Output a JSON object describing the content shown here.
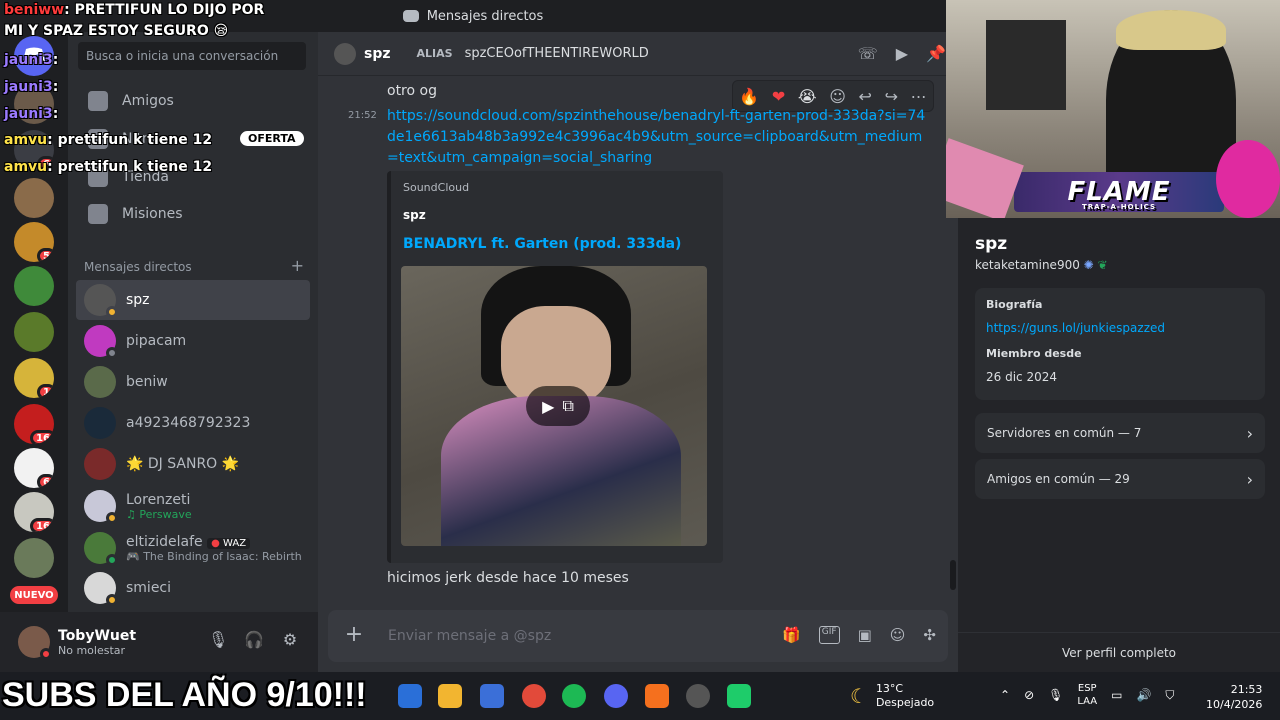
{
  "window": {
    "title": "Mensajes directos"
  },
  "sidebar": {
    "search_placeholder": "Busca o inicia una conversación",
    "nav": [
      {
        "label": "Amigos"
      },
      {
        "label": "Nitro"
      },
      {
        "label": "Tienda"
      },
      {
        "label": "Misiones"
      }
    ],
    "dm_header": "Mensajes directos",
    "dm_add": "+",
    "dms": [
      {
        "name": "spz",
        "sub": "",
        "active": true
      },
      {
        "name": "pipacam",
        "sub": ""
      },
      {
        "name": "beniw",
        "sub": ""
      },
      {
        "name": "a4923468792323",
        "sub": ""
      },
      {
        "name": "🌟 DJ SANRO 🌟",
        "sub": ""
      },
      {
        "name": "Lorenzeti",
        "sub": "♫ Perswave"
      },
      {
        "name": "eltizidelafe",
        "tag": "WAZ",
        "sub": "🎮 The Binding of Isaac: Rebirth"
      },
      {
        "name": "smieci",
        "sub": ""
      }
    ]
  },
  "rail": {
    "badges": [
      "6",
      "5",
      "1",
      "16",
      "6",
      "16"
    ],
    "nuevo": "NUEVO"
  },
  "user_panel": {
    "name": "TobyWuet",
    "status": "No molestar"
  },
  "chat": {
    "header": {
      "name": "spz",
      "alias_label": "ALIAS",
      "alias": "spzCEOofTHEENTIREWORLD"
    },
    "messages": [
      {
        "text": "otro og"
      },
      {
        "time": "21:52",
        "link": "https://soundcloud.com/spzinthehouse/benadryl-ft-garten-prod-333da?si=74de1e6613ab48b3a992e4c3996ac4b9&utm_source=clipboard&utm_medium=text&utm_campaign=social_sharing"
      },
      {
        "text": "hicimos jerk desde hace 10 meses"
      }
    ],
    "embed": {
      "provider": "SoundCloud",
      "author": "spz",
      "title": "BENADRYL ft. Garten (prod. 333da)"
    },
    "reactions": [
      "🔥",
      "❤",
      "😭"
    ],
    "composer_placeholder": "Enviar mensaje a @spz"
  },
  "profile": {
    "display_name": "spz",
    "username": "ketaketamine900",
    "bio_label": "Biografía",
    "bio_link": "https://guns.lol/junkiespazzed",
    "member_label": "Miembro desde",
    "member_since": "26 dic 2024",
    "mutual_servers": "Servidores en común — 7",
    "mutual_friends": "Amigos en común — 29",
    "full_profile": "Ver perfil completo"
  },
  "overlay": {
    "lines": [
      {
        "user": "beniww",
        "msg": ": PRETTIFUN LO DIJO POR"
      },
      {
        "user": "",
        "msg": "MI Y SPAZ ESTOY SEGURO 😪"
      },
      {
        "user": "jauni3",
        "msg": ":"
      },
      {
        "user": "jauni3",
        "msg": ":"
      },
      {
        "user": "jauni3",
        "msg": ":"
      },
      {
        "user": "amvu",
        "msg": ": prettifun k tiene 12"
      },
      {
        "user": "amvu",
        "msg": ": prettifun k tiene 12"
      }
    ],
    "oferta": "OFERTA",
    "webcam_banner": "FLAME",
    "webcam_sub": "TRAP-A-HOLICS",
    "subs": "SUBS DEL AÑO 9/10!!!"
  },
  "taskbar": {
    "temp": "13°C",
    "weather": "Despejado",
    "lang1": "ESP",
    "lang2": "LAA",
    "time": "21:53",
    "date": "10/4/2026"
  }
}
